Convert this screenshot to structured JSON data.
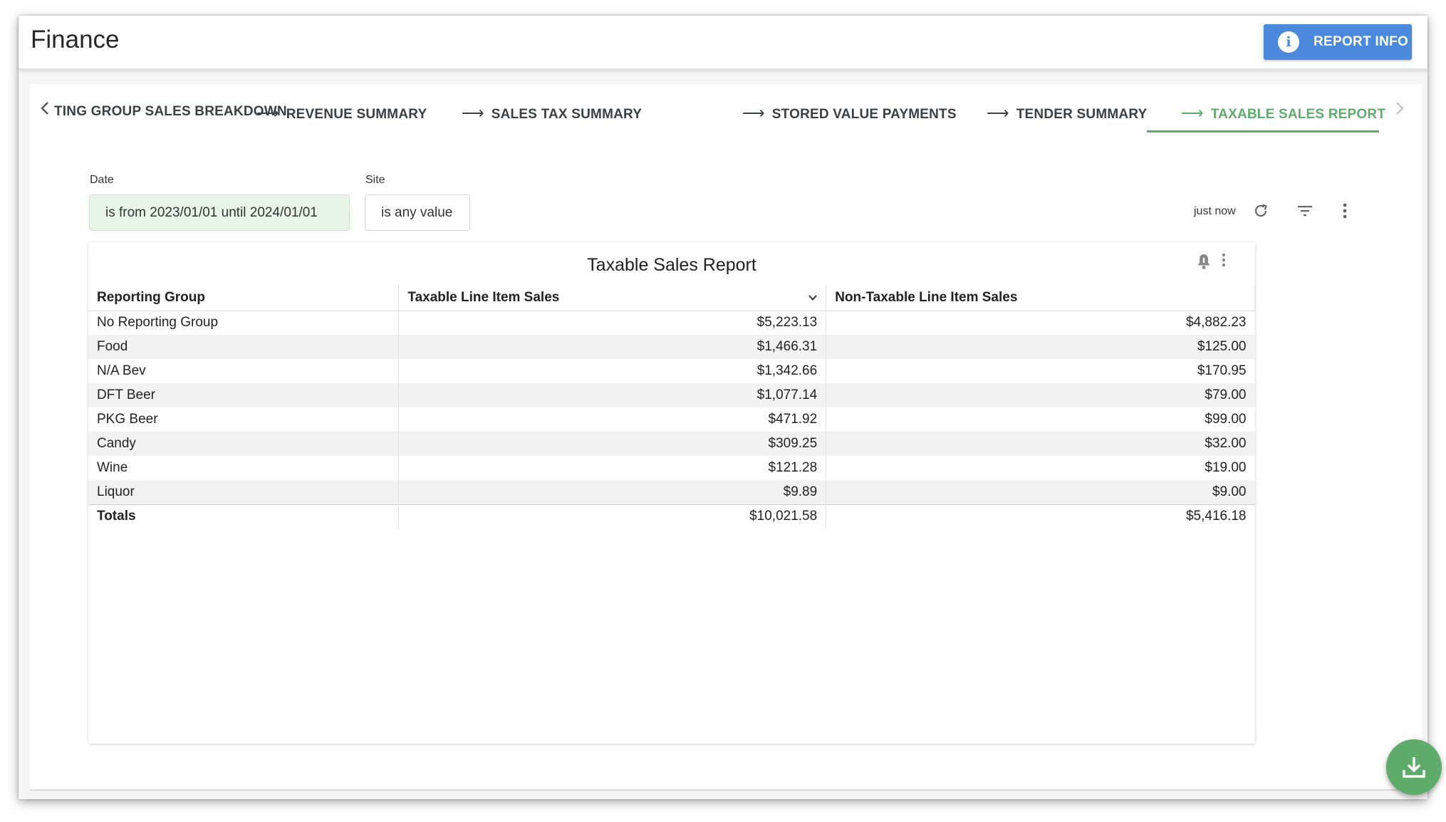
{
  "app": {
    "title": "Finance"
  },
  "header": {
    "report_info_label": "REPORT INFO",
    "info_glyph": "i"
  },
  "tabs": [
    {
      "label": "TING GROUP SALES BREAKDOWN"
    },
    {
      "label": "REVENUE SUMMARY"
    },
    {
      "label": "SALES TAX SUMMARY"
    },
    {
      "label": "STORED VALUE PAYMENTS"
    },
    {
      "label": "TENDER SUMMARY"
    },
    {
      "label": "TAXABLE SALES REPORT",
      "active": true
    }
  ],
  "filters": {
    "date": {
      "label": "Date",
      "value": "is from 2023/01/01 until 2024/01/01"
    },
    "site": {
      "label": "Site",
      "value": "is any value"
    }
  },
  "toolbar": {
    "refreshed": "just now"
  },
  "report": {
    "title": "Taxable Sales Report",
    "columns": [
      "Reporting Group",
      "Taxable Line Item Sales",
      "Non-Taxable Line Item Sales"
    ],
    "rows": [
      [
        "No Reporting Group",
        "$5,223.13",
        "$4,882.23"
      ],
      [
        "Food",
        "$1,466.31",
        "$125.00"
      ],
      [
        "N/A Bev",
        "$1,342.66",
        "$170.95"
      ],
      [
        "DFT Beer",
        "$1,077.14",
        "$79.00"
      ],
      [
        "PKG Beer",
        "$471.92",
        "$99.00"
      ],
      [
        "Candy",
        "$309.25",
        "$32.00"
      ],
      [
        "Wine",
        "$121.28",
        "$19.00"
      ],
      [
        "Liquor",
        "$9.89",
        "$9.00"
      ]
    ],
    "totals": [
      "Totals",
      "$10,021.58",
      "$5,416.18"
    ]
  },
  "colors": {
    "accent_green": "#5fab6c",
    "info_blue": "#4a89dc"
  },
  "icons": [
    "info-icon",
    "chevron-left-icon",
    "arrow-right-icon",
    "chevron-right-icon",
    "refresh-icon",
    "filter-icon",
    "more-vertical-icon",
    "bell-icon",
    "chevron-down-icon",
    "download-icon"
  ]
}
